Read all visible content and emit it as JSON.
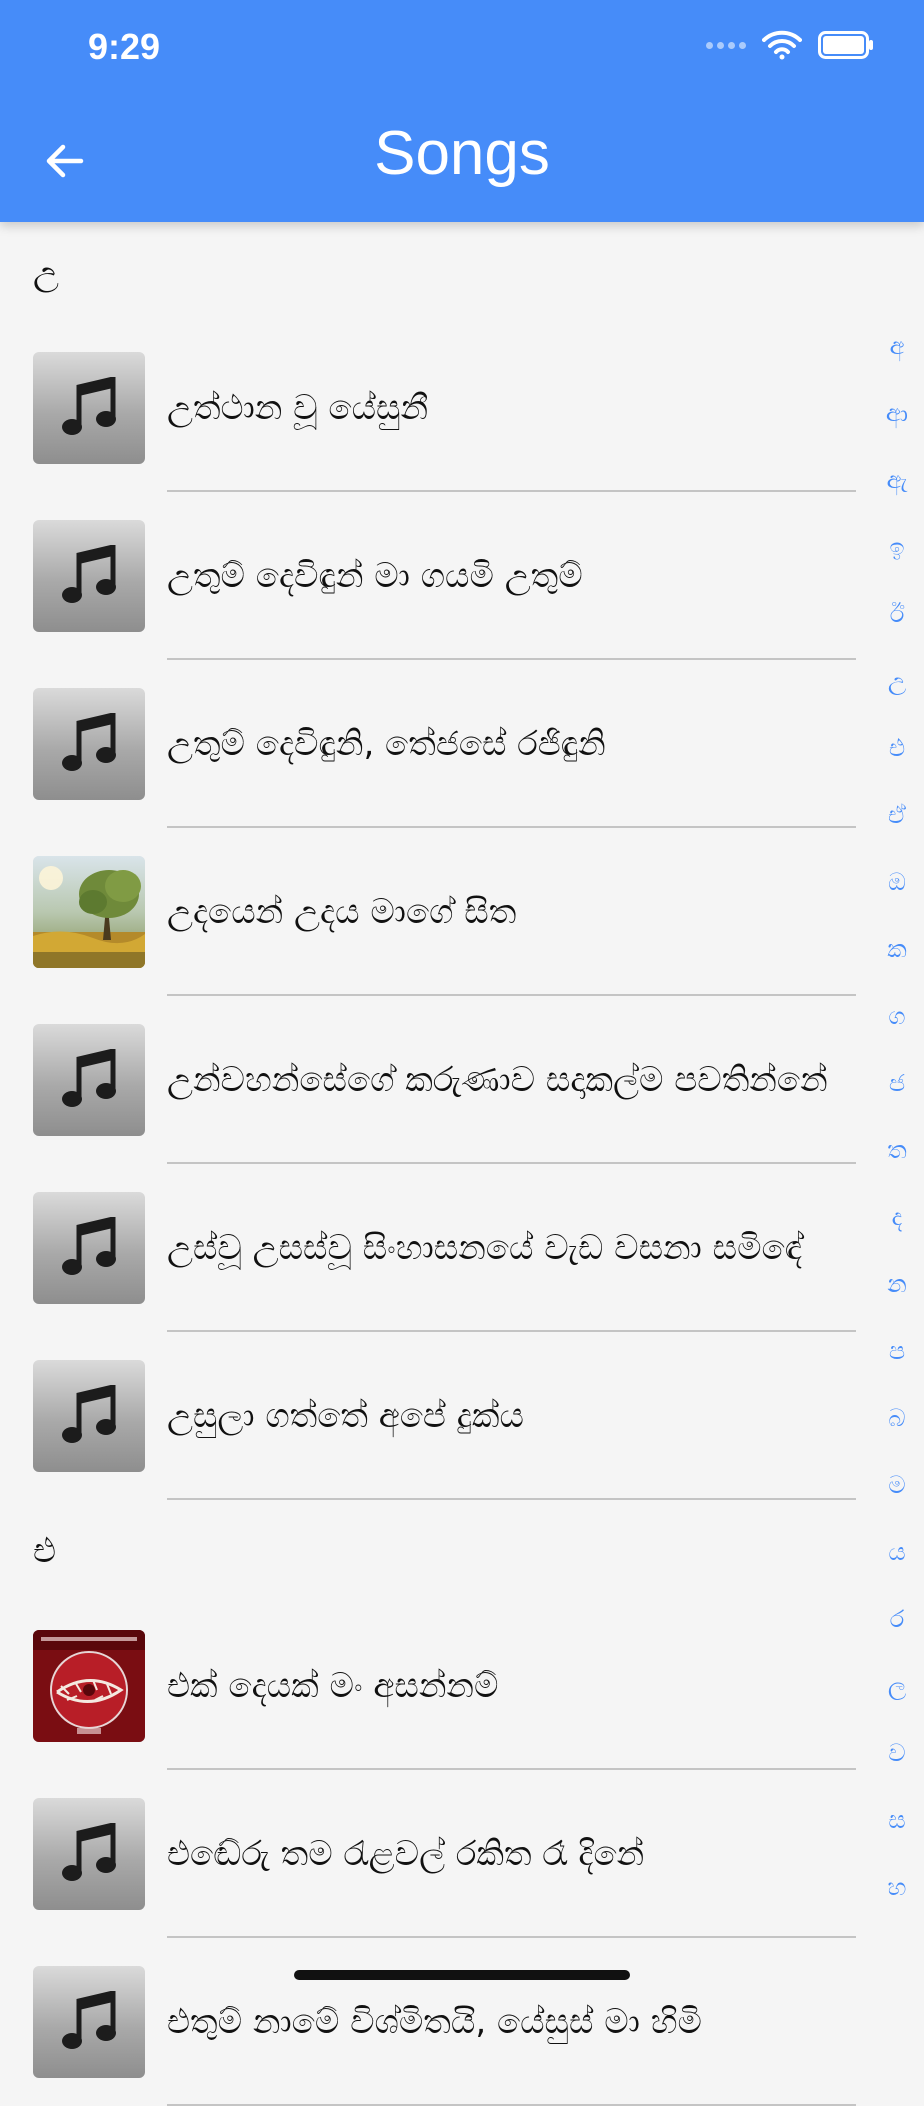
{
  "status_bar": {
    "time": "9:29"
  },
  "header": {
    "title": "Songs",
    "back_icon": "arrow-left-icon",
    "color": "#468cf9"
  },
  "sections": [
    {
      "letter": "උ",
      "songs": [
        {
          "title": "උත්ථාන වූ යේසුනී",
          "art": "music-note-icon"
        },
        {
          "title": "උතුම් දෙවිඳුන් මා ගයමි උතුම්",
          "art": "music-note-icon"
        },
        {
          "title": "උතුම් දෙවිඳුනි, තේජසේ රජිඳුනි",
          "art": "music-note-icon"
        },
        {
          "title": "උදයෙන් උදය මාගේ සිත",
          "art": "album-art-landscape"
        },
        {
          "title": "උන්වහන්සේගේ කරුණාව සදාකල්ම පවතින්නේ",
          "art": "music-note-icon"
        },
        {
          "title": "උස්වූ උසස්වූ සිංහාසනයේ වැඩ වසනා සමිඳේ",
          "art": "music-note-icon"
        },
        {
          "title": "උසුලා ගත්තේ අපේ දුක්ය",
          "art": "music-note-icon"
        }
      ]
    },
    {
      "letter": "එ",
      "songs": [
        {
          "title": "එක් දෙයක් මං අසන්නම්",
          "art": "album-art-crown-of-thorns"
        },
        {
          "title": "එඬේරු තම රැළවල් රකිත රෑ දිනේ",
          "art": "music-note-icon"
        },
        {
          "title": "එතුම් නාමේ විශ්මිතයි, යේසුස් මා හිමි",
          "art": "music-note-icon"
        }
      ]
    }
  ],
  "index_letters": [
    "අ",
    "ආ",
    "ඇ",
    "ඉ",
    "ඊ",
    "උ",
    "එ",
    "ඒ",
    "ඔ",
    "ක",
    "ග",
    "ජ",
    "ත",
    "ද",
    "න",
    "ප",
    "බ",
    "ම",
    "ය",
    "ර",
    "ල",
    "ව",
    "ස",
    "හ"
  ]
}
